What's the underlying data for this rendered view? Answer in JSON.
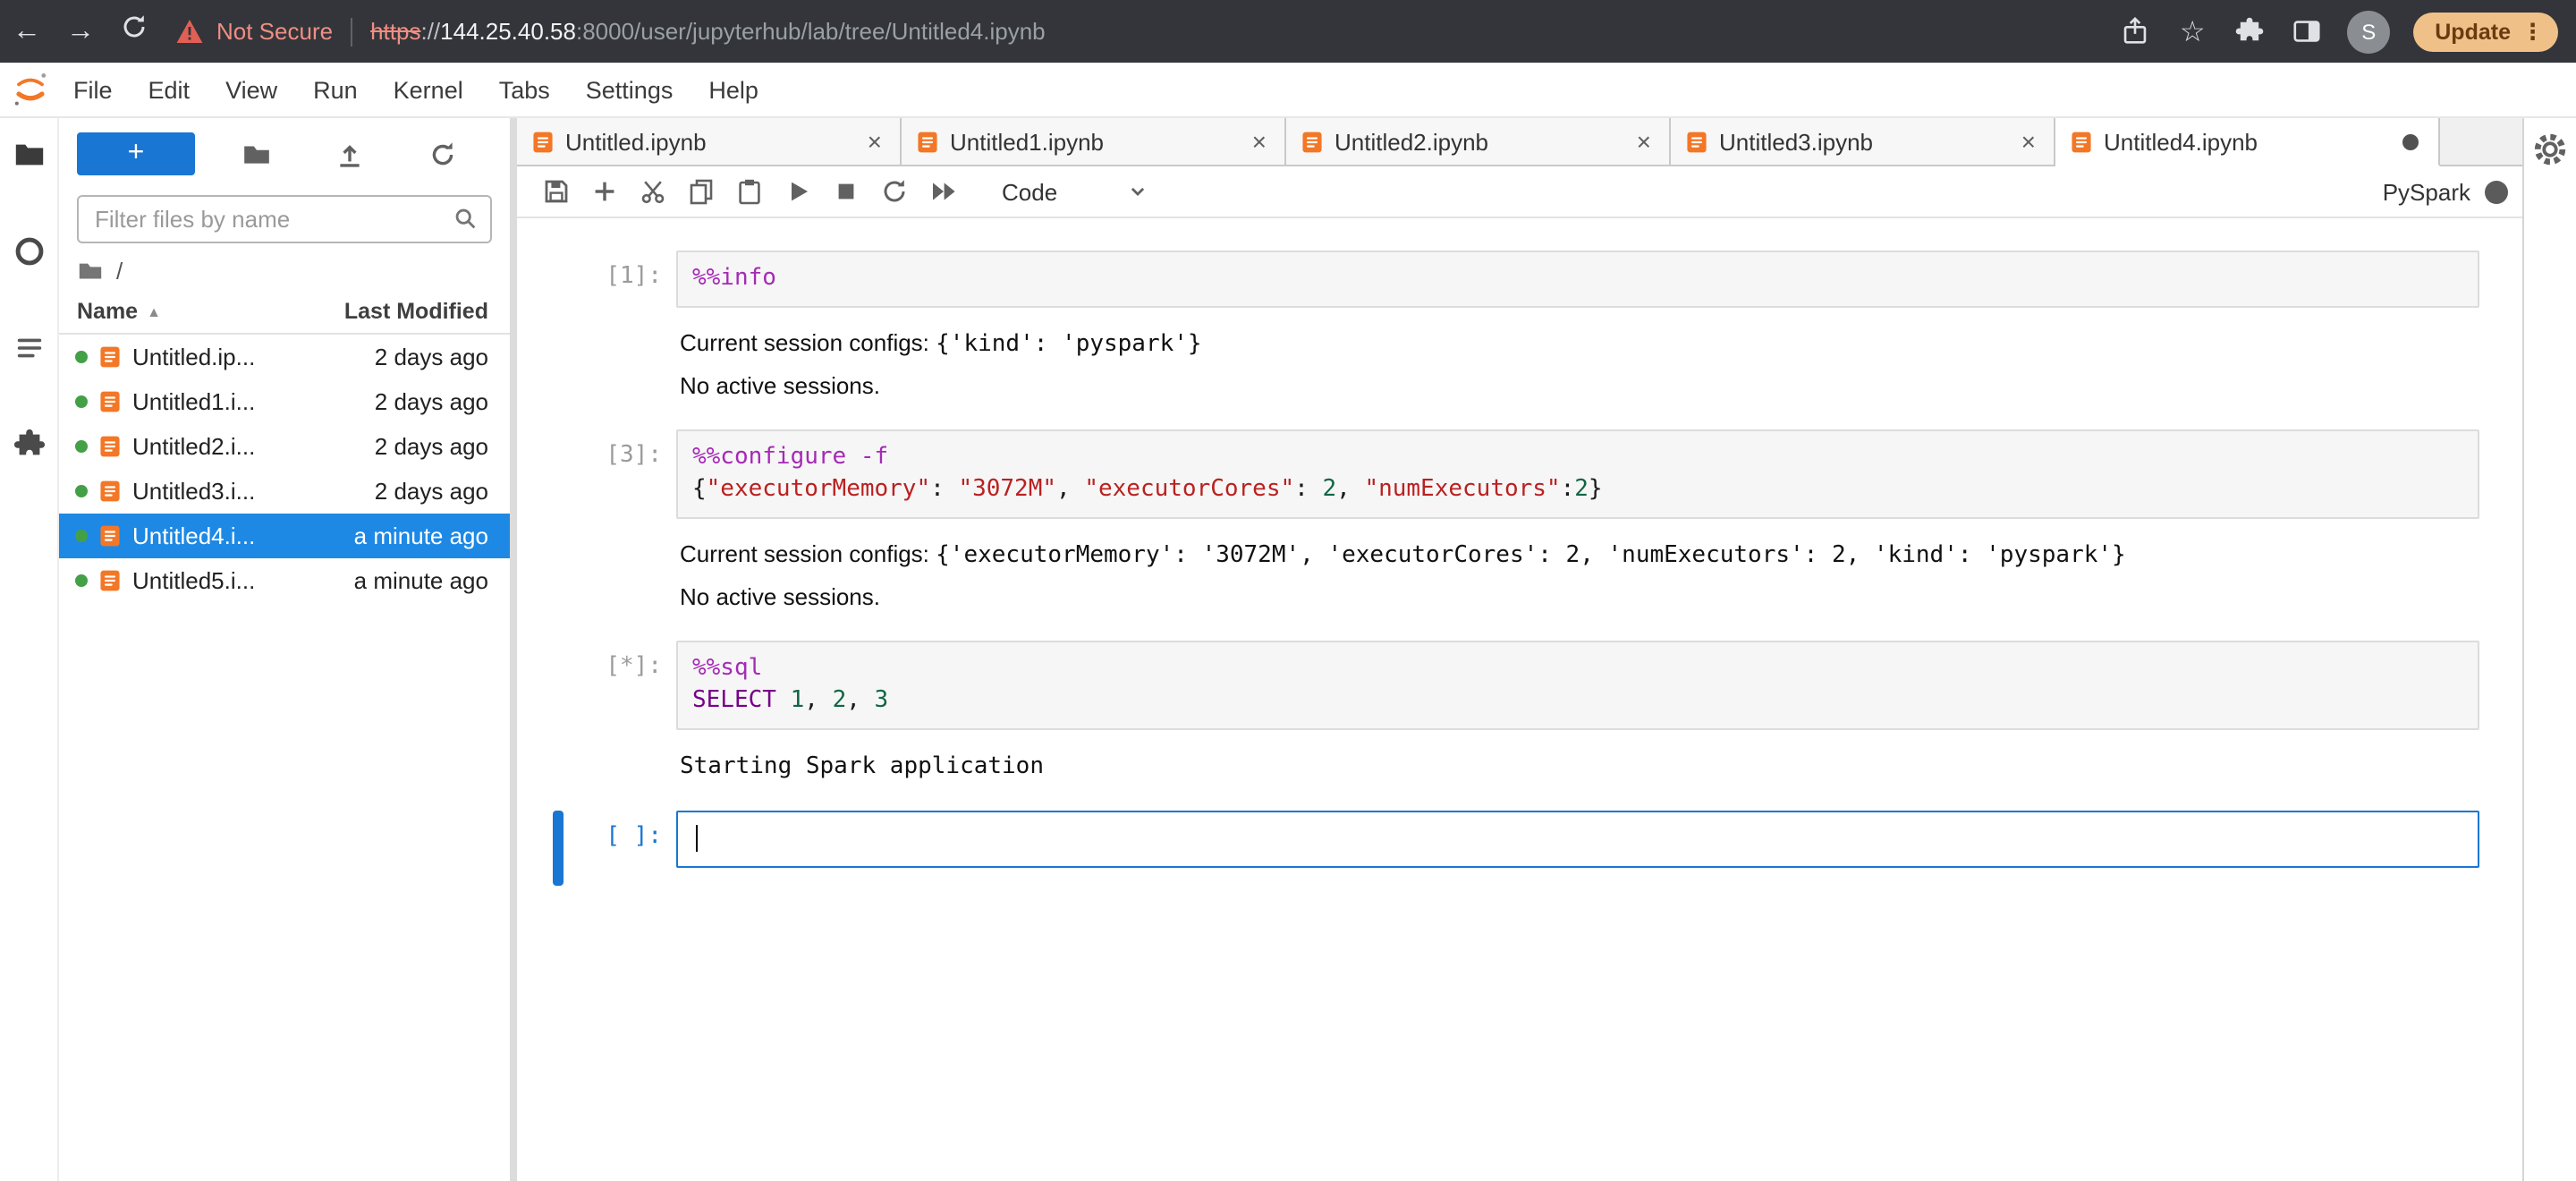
{
  "browser": {
    "nav": {
      "back_glyph": "←",
      "forward_glyph": "→"
    },
    "security": {
      "warning_label": "Not Secure"
    },
    "url": {
      "scheme": "https",
      "separator": "://",
      "host": "144.25.40.58",
      "path": ":8000/user/jupyterhub/lab/tree/Untitled4.ipynb"
    },
    "profile": {
      "avatar_letter": "S"
    },
    "update_button": {
      "label": "Update",
      "menu_glyph": "⋮"
    }
  },
  "menubar": {
    "items": [
      "File",
      "Edit",
      "View",
      "Run",
      "Kernel",
      "Tabs",
      "Settings",
      "Help"
    ]
  },
  "activitybar": {
    "items": [
      {
        "icon": "file-browser-icon",
        "active": true
      },
      {
        "icon": "running-sessions-icon",
        "active": false
      },
      {
        "icon": "table-of-contents-icon",
        "active": false
      },
      {
        "icon": "extensions-icon",
        "active": false
      }
    ]
  },
  "filebrowser": {
    "new_launcher_label": "+",
    "filter_placeholder": "Filter files by name",
    "breadcrumb_root": "/",
    "columns": {
      "name": "Name",
      "modified": "Last Modified",
      "sort_glyph": "▲"
    },
    "files": [
      {
        "name": "Untitled.ip...",
        "modified": "2 days ago",
        "running": true,
        "selected": false
      },
      {
        "name": "Untitled1.i...",
        "modified": "2 days ago",
        "running": true,
        "selected": false
      },
      {
        "name": "Untitled2.i...",
        "modified": "2 days ago",
        "running": true,
        "selected": false
      },
      {
        "name": "Untitled3.i...",
        "modified": "2 days ago",
        "running": true,
        "selected": false
      },
      {
        "name": "Untitled4.i...",
        "modified": "a minute ago",
        "running": true,
        "selected": true
      },
      {
        "name": "Untitled5.i...",
        "modified": "a minute ago",
        "running": true,
        "selected": false
      }
    ]
  },
  "tabbar": {
    "close_glyph": "×",
    "tabs": [
      {
        "label": "Untitled.ipynb",
        "active": false,
        "dirty": false
      },
      {
        "label": "Untitled1.ipynb",
        "active": false,
        "dirty": false
      },
      {
        "label": "Untitled2.ipynb",
        "active": false,
        "dirty": false
      },
      {
        "label": "Untitled3.ipynb",
        "active": false,
        "dirty": false
      },
      {
        "label": "Untitled4.ipynb",
        "active": true,
        "dirty": true
      }
    ]
  },
  "nbtoolbar": {
    "cell_type": "Code",
    "kernel_name": "PySpark",
    "kernel_status": "busy"
  },
  "notebook": {
    "cells": [
      {
        "prompt": "[1]:",
        "active": false,
        "lines": [
          [
            {
              "t": "%%info",
              "s": "magic"
            }
          ]
        ],
        "outputs": [
          {
            "parts": [
              {
                "t": "Current session configs: ",
                "f": "sans"
              },
              {
                "t": "{'kind': 'pyspark'}",
                "f": "mono"
              }
            ]
          },
          {
            "parts": [
              {
                "t": "No active sessions.",
                "f": "sans"
              }
            ]
          }
        ]
      },
      {
        "prompt": "[3]:",
        "active": false,
        "lines": [
          [
            {
              "t": "%%configure -f",
              "s": "magic"
            }
          ],
          [
            {
              "t": "{",
              "s": "plain"
            },
            {
              "t": "\"executorMemory\"",
              "s": "string"
            },
            {
              "t": ": ",
              "s": "plain"
            },
            {
              "t": "\"3072M\"",
              "s": "string"
            },
            {
              "t": ", ",
              "s": "plain"
            },
            {
              "t": "\"executorCores\"",
              "s": "string"
            },
            {
              "t": ": ",
              "s": "plain"
            },
            {
              "t": "2",
              "s": "number"
            },
            {
              "t": ", ",
              "s": "plain"
            },
            {
              "t": "\"numExecutors\"",
              "s": "string"
            },
            {
              "t": ":",
              "s": "plain"
            },
            {
              "t": "2",
              "s": "number"
            },
            {
              "t": "}",
              "s": "plain"
            }
          ]
        ],
        "outputs": [
          {
            "parts": [
              {
                "t": "Current session configs: ",
                "f": "sans"
              },
              {
                "t": "{'executorMemory': '3072M', 'executorCores': 2, 'numExecutors': 2, 'kind': 'pyspark'}",
                "f": "mono"
              }
            ]
          },
          {
            "parts": [
              {
                "t": "No active sessions.",
                "f": "sans"
              }
            ]
          }
        ]
      },
      {
        "prompt": "[*]:",
        "active": false,
        "lines": [
          [
            {
              "t": "%%sql",
              "s": "magic"
            }
          ],
          [
            {
              "t": "SELECT",
              "s": "keyword"
            },
            {
              "t": " ",
              "s": "plain"
            },
            {
              "t": "1",
              "s": "number"
            },
            {
              "t": ", ",
              "s": "plain"
            },
            {
              "t": "2",
              "s": "number"
            },
            {
              "t": ", ",
              "s": "plain"
            },
            {
              "t": "3",
              "s": "number"
            }
          ]
        ],
        "outputs": [
          {
            "parts": [
              {
                "t": "Starting Spark application",
                "f": "mono"
              }
            ]
          }
        ]
      },
      {
        "prompt": "[ ]:",
        "active": true,
        "lines": [],
        "outputs": []
      }
    ]
  },
  "colors": {
    "accent": "#1976d2",
    "selection": "#1e88e5",
    "notebook_icon": "#f37726",
    "running_dot": "#43a047",
    "magic": "#a52ab5",
    "keyword": "#770088",
    "string": "#ba2121",
    "number": "#116644",
    "security_warning": "#f08e84",
    "update_pill": "#efc188"
  }
}
